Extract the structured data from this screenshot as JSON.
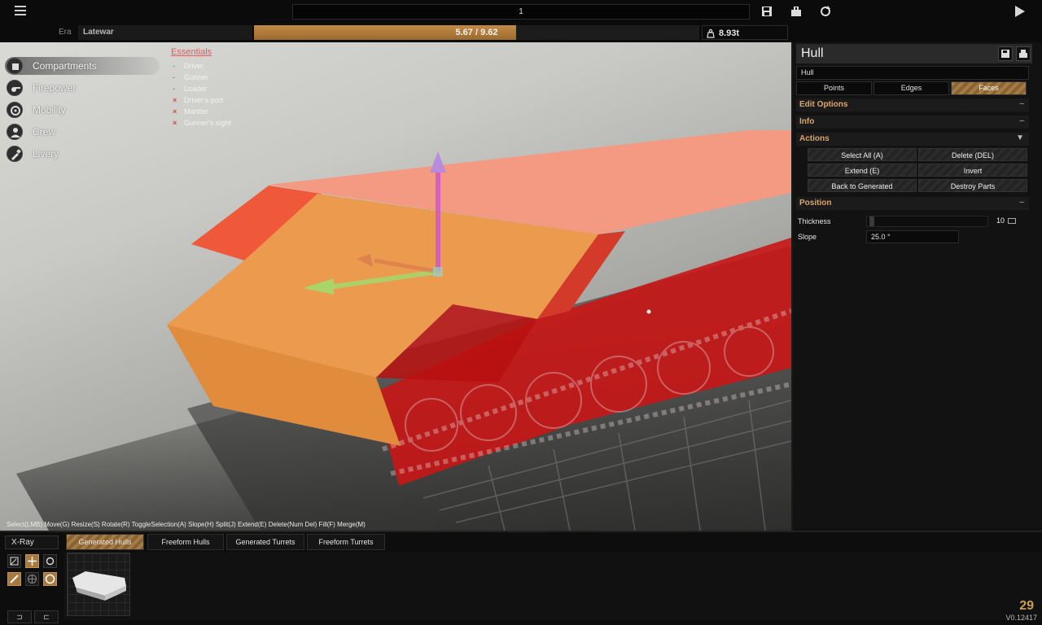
{
  "topbar": {
    "title_value": "1",
    "icons": [
      "save-icon",
      "upload-icon",
      "reset-icon",
      "play-icon"
    ]
  },
  "infobar": {
    "era_label": "Era",
    "era_value": "Latewar",
    "cost_current": 5.67,
    "cost_max": 9.62,
    "cost_text": "5.67 / 9.62",
    "weight_text": "8.93t"
  },
  "nav": {
    "items": [
      {
        "label": "Compartments",
        "icon": "box-icon",
        "active": true
      },
      {
        "label": "Firepower",
        "icon": "cannon-icon",
        "active": false
      },
      {
        "label": "Mobility",
        "icon": "wheel-icon",
        "active": false
      },
      {
        "label": "Crew",
        "icon": "person-icon",
        "active": false
      },
      {
        "label": "Livery",
        "icon": "brush-icon",
        "active": false
      }
    ]
  },
  "essentials": {
    "title": "Essentials",
    "items": [
      {
        "label": "Driver",
        "ok": true
      },
      {
        "label": "Gunner",
        "ok": true
      },
      {
        "label": "Loader",
        "ok": true
      },
      {
        "label": "Driver's port",
        "ok": false
      },
      {
        "label": "Mantlet",
        "ok": false
      },
      {
        "label": "Gunner's sight",
        "ok": false
      }
    ],
    "ok_mark": "-",
    "bad_mark": "×"
  },
  "hint": "Select(LMB) Move(G) Resize(S) Rotate(R) ToggleSelection(A) Slope(H) Split(J) Extend(E) Delete(Num Del) Fill(F) Merge(M)",
  "panel": {
    "title": "Hull",
    "hull_field": "Hull",
    "modes": [
      "Points",
      "Edges",
      "Faces"
    ],
    "active_mode": "Faces",
    "sections": {
      "edit_options": "Edit Options",
      "info": "Info",
      "actions": "Actions",
      "position": "Position"
    },
    "toggles": {
      "collapse": "–",
      "expand": "▼"
    },
    "actions": {
      "select_all": "Select All (A)",
      "delete": "Delete (DEL)",
      "extend": "Extend (E)",
      "invert": "Invert",
      "back_to_generated": "Back to Generated",
      "destroy_parts": "Destroy Parts"
    },
    "thickness_label": "Thickness",
    "thickness_value": "10",
    "thickness_fraction": 0.02,
    "slope_label": "Slope",
    "slope_value": "25.0 °"
  },
  "bottom": {
    "xray_label": "X-Ray",
    "tabs": [
      "Generated Hulls",
      "Freeform Hulls",
      "Generated Turrets",
      "Freeform Turrets"
    ],
    "active_tab": "Generated Hulls",
    "fps": "29",
    "version": "V0.12417"
  },
  "colors": {
    "accent": "#a57b46",
    "hull_orange": "#ec9a4e",
    "hull_red": "#c91616",
    "hull_salmon": "#f49a82",
    "section_text": "#d9a66a",
    "error": "#e04040",
    "ok": "#5ab85a"
  }
}
